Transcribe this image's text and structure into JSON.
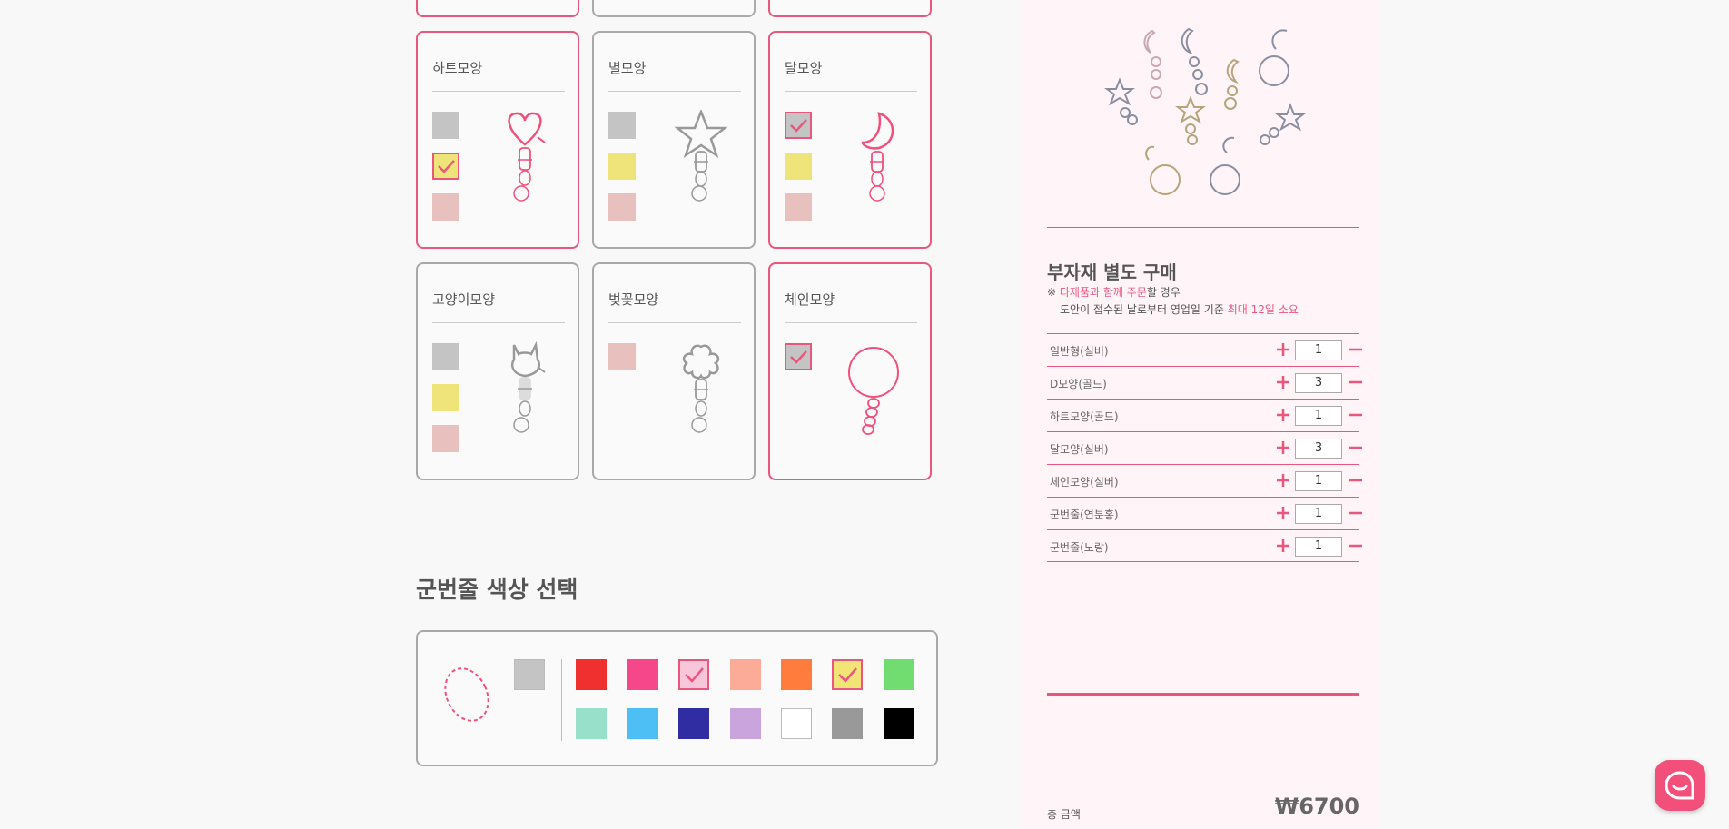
{
  "shapes": [
    {
      "label": "하트모양",
      "selected": true
    },
    {
      "label": "별모양",
      "selected": false
    },
    {
      "label": "달모양",
      "selected": true
    },
    {
      "label": "고양이모양",
      "selected": false
    },
    {
      "label": "벚꽃모양",
      "selected": false
    },
    {
      "label": "체인모양",
      "selected": true
    }
  ],
  "strap_section": {
    "title": "군번줄 색상 선택",
    "colors_row1": [
      "#c4c4c4",
      "#f0302f",
      "#f5478a",
      "#f7c6d8",
      "#fbab98",
      "#ff7c3c",
      "#f3e477",
      "#71dd71"
    ],
    "colors_row2": [
      "#98e0c9",
      "#4dbff5",
      "#2f2da1",
      "#caa4dd",
      "#ffffff",
      "#999999",
      "#000000"
    ],
    "checked": [
      "#f7c6d8",
      "#f3e477"
    ]
  },
  "side": {
    "title": "부자재 별도 구매",
    "note_prefix": "※ ",
    "note_highlight1": "타제품과 함께 주문",
    "note_mid": "할 경우",
    "note_line2": "도안이 접수된 날로부터 영업일 기준 ",
    "note_highlight2": "최대 12일 소요",
    "options": [
      {
        "label": "일반형(실버)",
        "qty": "1"
      },
      {
        "label": "D모양(골드)",
        "qty": "3"
      },
      {
        "label": "하트모양(골드)",
        "qty": "1"
      },
      {
        "label": "달모양(실버)",
        "qty": "3"
      },
      {
        "label": "체인모양(실버)",
        "qty": "1"
      },
      {
        "label": "군번줄(연분홍)",
        "qty": "1"
      },
      {
        "label": "군번줄(노랑)",
        "qty": "1"
      }
    ],
    "total_label": "총 금액",
    "total_value": "₩6700"
  },
  "colors": {
    "accent": "#e9577f",
    "gray_swatch": "#c4c4c4",
    "yellow_swatch": "#efe47a",
    "pink_swatch": "#e8c0bd"
  },
  "icons": [
    "check-icon",
    "plus-icon",
    "minus-icon",
    "chat-icon"
  ]
}
